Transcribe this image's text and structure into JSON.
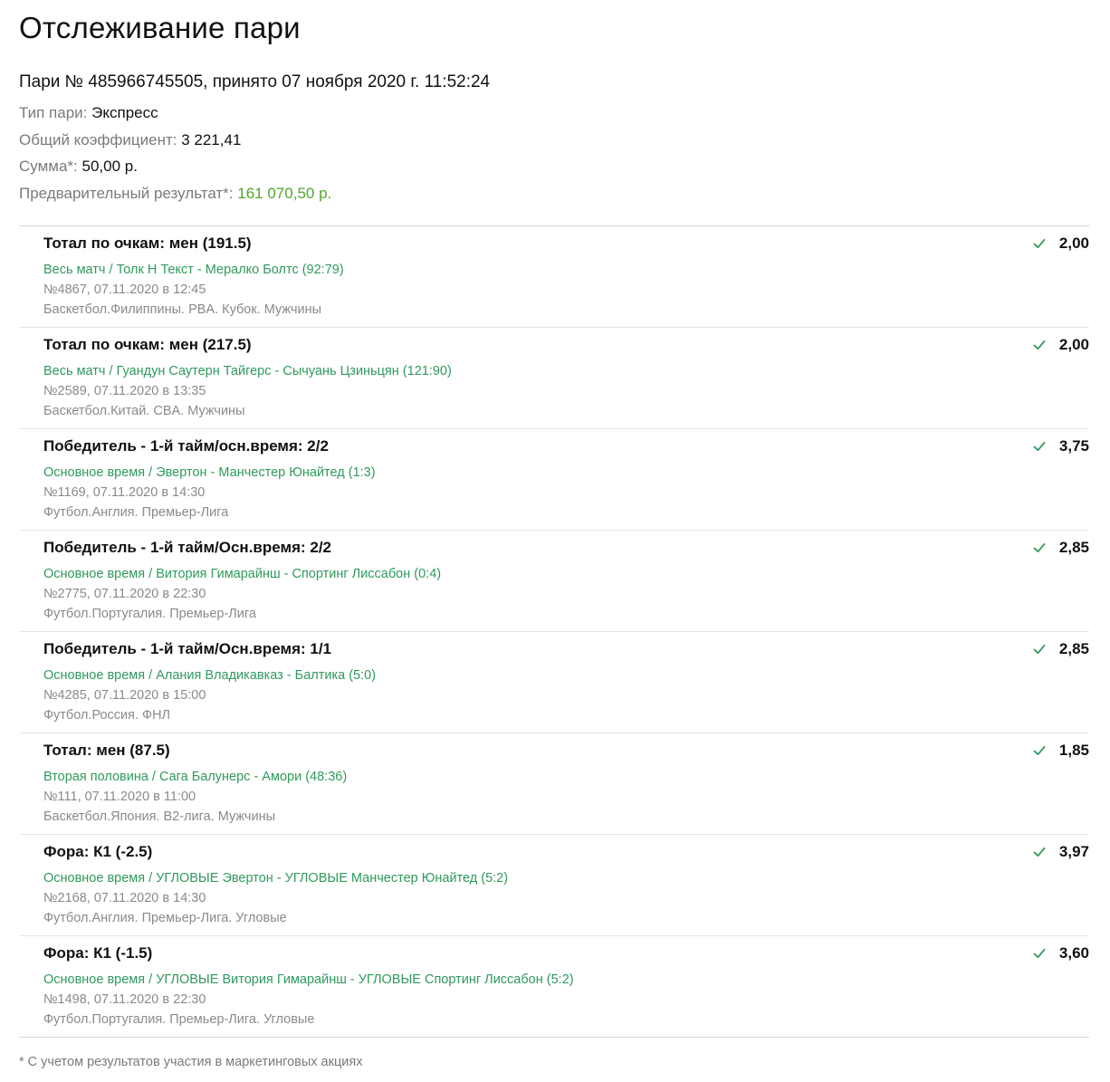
{
  "page": {
    "title": "Отслеживание пари",
    "bet_header": "Пари № 485966745505, принято 07 ноября 2020 г. 11:52:24",
    "bet_type": {
      "label": "Тип пари:",
      "value": "Экспресс"
    },
    "total_odds": {
      "label": "Общий коэффициент:",
      "value": "3 221,41"
    },
    "stake": {
      "label": "Сумма*:",
      "value": "50,00 р."
    },
    "preliminary_result": {
      "label": "Предварительный результат*:",
      "value": "161 070,50 р."
    },
    "footnote": "* С учетом результатов участия в маркетинговых акциях"
  },
  "colors": {
    "match_link": "#2f9a5c",
    "result_value": "#55a42a",
    "check_icon": "#2f9a5c"
  },
  "events": [
    {
      "market": "Тотал по очкам: мен (191.5)",
      "match": "Весь матч / Толк Н Текст - Мералко Болтс (92:79)",
      "number": "№4867, 07.11.2020 в 12:45",
      "league": "Баскетбол.Филиппины. PBA. Кубок. Мужчины",
      "odds": "2,00",
      "status_icon": "check-icon"
    },
    {
      "market": "Тотал по очкам: мен (217.5)",
      "match": "Весь матч / Гуандун Саутерн Тайгерс - Сычуань Цзиньцян (121:90)",
      "number": "№2589, 07.11.2020 в 13:35",
      "league": "Баскетбол.Китай. CBA. Мужчины",
      "odds": "2,00",
      "status_icon": "check-icon"
    },
    {
      "market": "Победитель - 1-й тайм/осн.время: 2/2",
      "match": "Основное время / Эвертон - Манчестер Юнайтед (1:3)",
      "number": "№1169, 07.11.2020 в 14:30",
      "league": "Футбол.Англия. Премьер-Лига",
      "odds": "3,75",
      "status_icon": "check-icon"
    },
    {
      "market": "Победитель - 1-й тайм/Осн.время: 2/2",
      "match": "Основное время / Витория Гимарайнш - Спортинг Лиссабон (0:4)",
      "number": "№2775, 07.11.2020 в 22:30",
      "league": "Футбол.Португалия. Премьер-Лига",
      "odds": "2,85",
      "status_icon": "check-icon"
    },
    {
      "market": "Победитель - 1-й тайм/Осн.время: 1/1",
      "match": "Основное время / Алания Владикавказ - Балтика (5:0)",
      "number": "№4285, 07.11.2020 в 15:00",
      "league": "Футбол.Россия. ФНЛ",
      "odds": "2,85",
      "status_icon": "check-icon"
    },
    {
      "market": "Тотал: мен (87.5)",
      "match": "Вторая половина / Сага Балунерс - Амори (48:36)",
      "number": "№111, 07.11.2020 в 11:00",
      "league": "Баскетбол.Япония. B2-лига. Мужчины",
      "odds": "1,85",
      "status_icon": "check-icon"
    },
    {
      "market": "Фора: К1 (-2.5)",
      "match": "Основное время / УГЛОВЫЕ Эвертон - УГЛОВЫЕ Манчестер Юнайтед (5:2)",
      "number": "№2168, 07.11.2020 в 14:30",
      "league": "Футбол.Англия. Премьер-Лига. Угловые",
      "odds": "3,97",
      "status_icon": "check-icon"
    },
    {
      "market": "Фора: К1 (-1.5)",
      "match": "Основное время / УГЛОВЫЕ Витория Гимарайнш - УГЛОВЫЕ Спортинг Лиссабон (5:2)",
      "number": "№1498, 07.11.2020 в 22:30",
      "league": "Футбол.Португалия. Премьер-Лига. Угловые",
      "odds": "3,60",
      "status_icon": "check-icon"
    }
  ]
}
